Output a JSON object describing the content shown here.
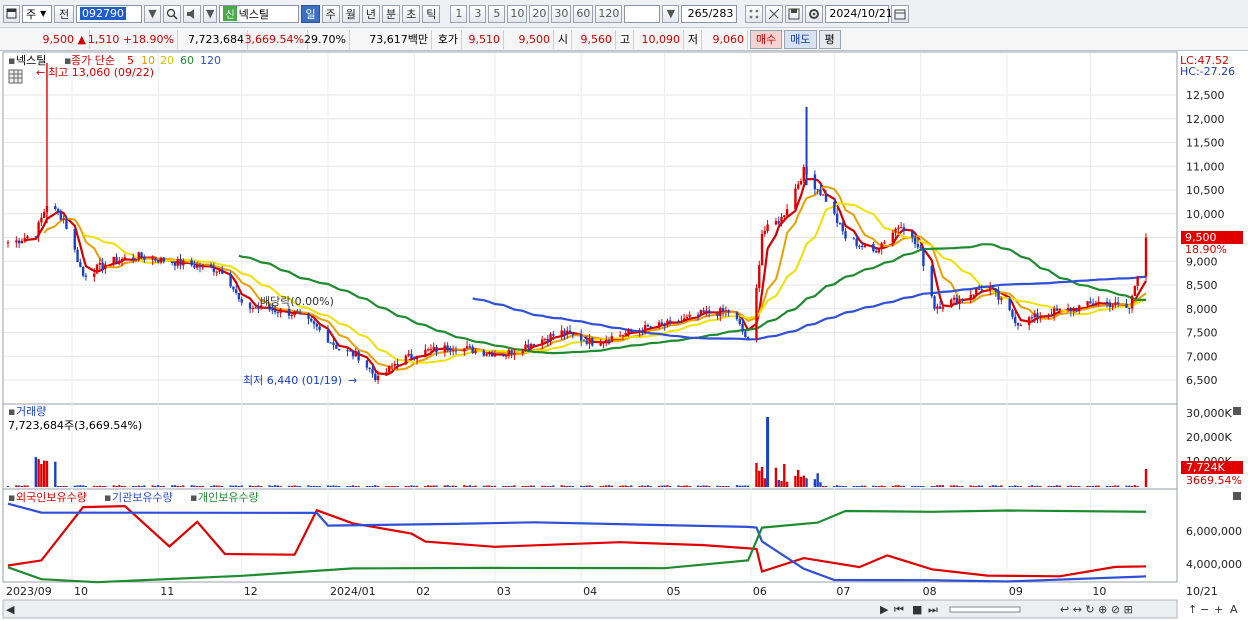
{
  "toolbar": {
    "period": "주",
    "prev": "전",
    "code": "092790",
    "badge": "신",
    "name": "넥스틸",
    "tabs": [
      "일",
      "주",
      "월",
      "년",
      "분",
      "초",
      "틱"
    ],
    "active_tab": "일",
    "intervals": [
      "1",
      "3",
      "5",
      "10",
      "20",
      "30",
      "60",
      "120"
    ],
    "count": "265",
    "total": "/283",
    "date": "2024/10/21"
  },
  "quote": {
    "price": "9,500",
    "arrow": "▲",
    "change": "1,510",
    "change_pct": "+18.90%",
    "volume": "7,723,684",
    "vol_ratio": "3,669.54%",
    "turnover": "29.70%",
    "amount": "73,617백만",
    "hoga_label": "호가",
    "ask": "9,510",
    "bid": "9,500",
    "open_label": "시",
    "open": "9,560",
    "high_label": "고",
    "high": "10,090",
    "low_label": "저",
    "low": "9,060",
    "buy": "매수",
    "sell": "매도",
    "eval": "평"
  },
  "legend": {
    "title": "넥스틸",
    "series": "종가 단순",
    "ma": [
      {
        "label": "5",
        "color": "#d40000"
      },
      {
        "label": "10",
        "color": "#e8a000"
      },
      {
        "label": "20",
        "color": "#d0c000"
      },
      {
        "label": "60",
        "color": "#1f8b2f"
      },
      {
        "label": "120",
        "color": "#2f4fd8"
      }
    ]
  },
  "right_labels": {
    "lc": "LC:47.52",
    "hc": "HC:-27.26"
  },
  "annotations": {
    "high": "최고 13,060 (09/22)",
    "low": "최저 6,440 (01/19)",
    "dividend": "배당락(0.00%)"
  },
  "price_tag": {
    "price": "9,500",
    "pct": "18.90%"
  },
  "volume_panel": {
    "title": "거래량",
    "info": "7,723,684주(3,669.54%)",
    "tag": "7,724K",
    "tag_pct": "3669.54%",
    "ticks": [
      "30,000K",
      "20,000K",
      "10,000K"
    ]
  },
  "holdings_panel": {
    "series": [
      {
        "name": "외국인보유수량",
        "color": "#e00000"
      },
      {
        "name": "기관보유수량",
        "color": "#2f4fd8"
      },
      {
        "name": "개인보유수량",
        "color": "#1f8b2f"
      }
    ],
    "ticks": [
      "6,000,000",
      "4,000,000"
    ]
  },
  "x_labels": [
    "2023/09",
    "10",
    "11",
    "12",
    "2024/01",
    "02",
    "03",
    "04",
    "05",
    "06",
    "07",
    "08",
    "09",
    "10"
  ],
  "x_end": "10/21",
  "chart_data": {
    "type": "line",
    "title": "넥스틸",
    "price_axis_ticks": [
      12500,
      12000,
      11500,
      11000,
      10500,
      10000,
      9500,
      9000,
      8500,
      8000,
      7500,
      7000,
      6500
    ],
    "close": [
      {
        "x": "2023/09/10",
        "y": 9400
      },
      {
        "x": "2023/09/18",
        "y": 9600
      },
      {
        "x": "2023/09/22",
        "y": 10200
      },
      {
        "x": "2023/09/28",
        "y": 9900
      },
      {
        "x": "2023/10/05",
        "y": 8700
      },
      {
        "x": "2023/10/15",
        "y": 9000
      },
      {
        "x": "2023/10/25",
        "y": 9100
      },
      {
        "x": "2023/11/05",
        "y": 9000
      },
      {
        "x": "2023/11/15",
        "y": 8900
      },
      {
        "x": "2023/11/25",
        "y": 8800
      },
      {
        "x": "2023/12/01",
        "y": 8050
      },
      {
        "x": "2023/12/10",
        "y": 8000
      },
      {
        "x": "2023/12/20",
        "y": 7900
      },
      {
        "x": "2023/12/28",
        "y": 7600
      },
      {
        "x": "2024/01/05",
        "y": 7150
      },
      {
        "x": "2024/01/12",
        "y": 7000
      },
      {
        "x": "2024/01/19",
        "y": 6500
      },
      {
        "x": "2024/01/26",
        "y": 6900
      },
      {
        "x": "2024/02/05",
        "y": 7100
      },
      {
        "x": "2024/02/15",
        "y": 7200
      },
      {
        "x": "2024/02/25",
        "y": 7100
      },
      {
        "x": "2024/03/05",
        "y": 7050
      },
      {
        "x": "2024/03/15",
        "y": 7300
      },
      {
        "x": "2024/03/25",
        "y": 7500
      },
      {
        "x": "2024/04/05",
        "y": 7300
      },
      {
        "x": "2024/04/15",
        "y": 7450
      },
      {
        "x": "2024/04/25",
        "y": 7600
      },
      {
        "x": "2024/05/05",
        "y": 7700
      },
      {
        "x": "2024/05/15",
        "y": 7900
      },
      {
        "x": "2024/05/25",
        "y": 7950
      },
      {
        "x": "2024/06/01",
        "y": 7200
      },
      {
        "x": "2024/06/05",
        "y": 9600
      },
      {
        "x": "2024/06/12",
        "y": 9900
      },
      {
        "x": "2024/06/20",
        "y": 10900
      },
      {
        "x": "2024/06/28",
        "y": 10300
      },
      {
        "x": "2024/07/05",
        "y": 9500
      },
      {
        "x": "2024/07/15",
        "y": 9200
      },
      {
        "x": "2024/07/25",
        "y": 9800
      },
      {
        "x": "2024/08/01",
        "y": 9200
      },
      {
        "x": "2024/08/06",
        "y": 8050
      },
      {
        "x": "2024/08/15",
        "y": 8200
      },
      {
        "x": "2024/08/25",
        "y": 8500
      },
      {
        "x": "2024/09/05",
        "y": 7700
      },
      {
        "x": "2024/09/15",
        "y": 7900
      },
      {
        "x": "2024/09/25",
        "y": 8000
      },
      {
        "x": "2024/10/05",
        "y": 8150
      },
      {
        "x": "2024/10/15",
        "y": 8000
      },
      {
        "x": "2024/10/21",
        "y": 9500
      }
    ],
    "last_price": 9500,
    "high": {
      "value": 13060,
      "date": "09/22"
    },
    "low": {
      "value": 6440,
      "date": "01/19"
    }
  }
}
